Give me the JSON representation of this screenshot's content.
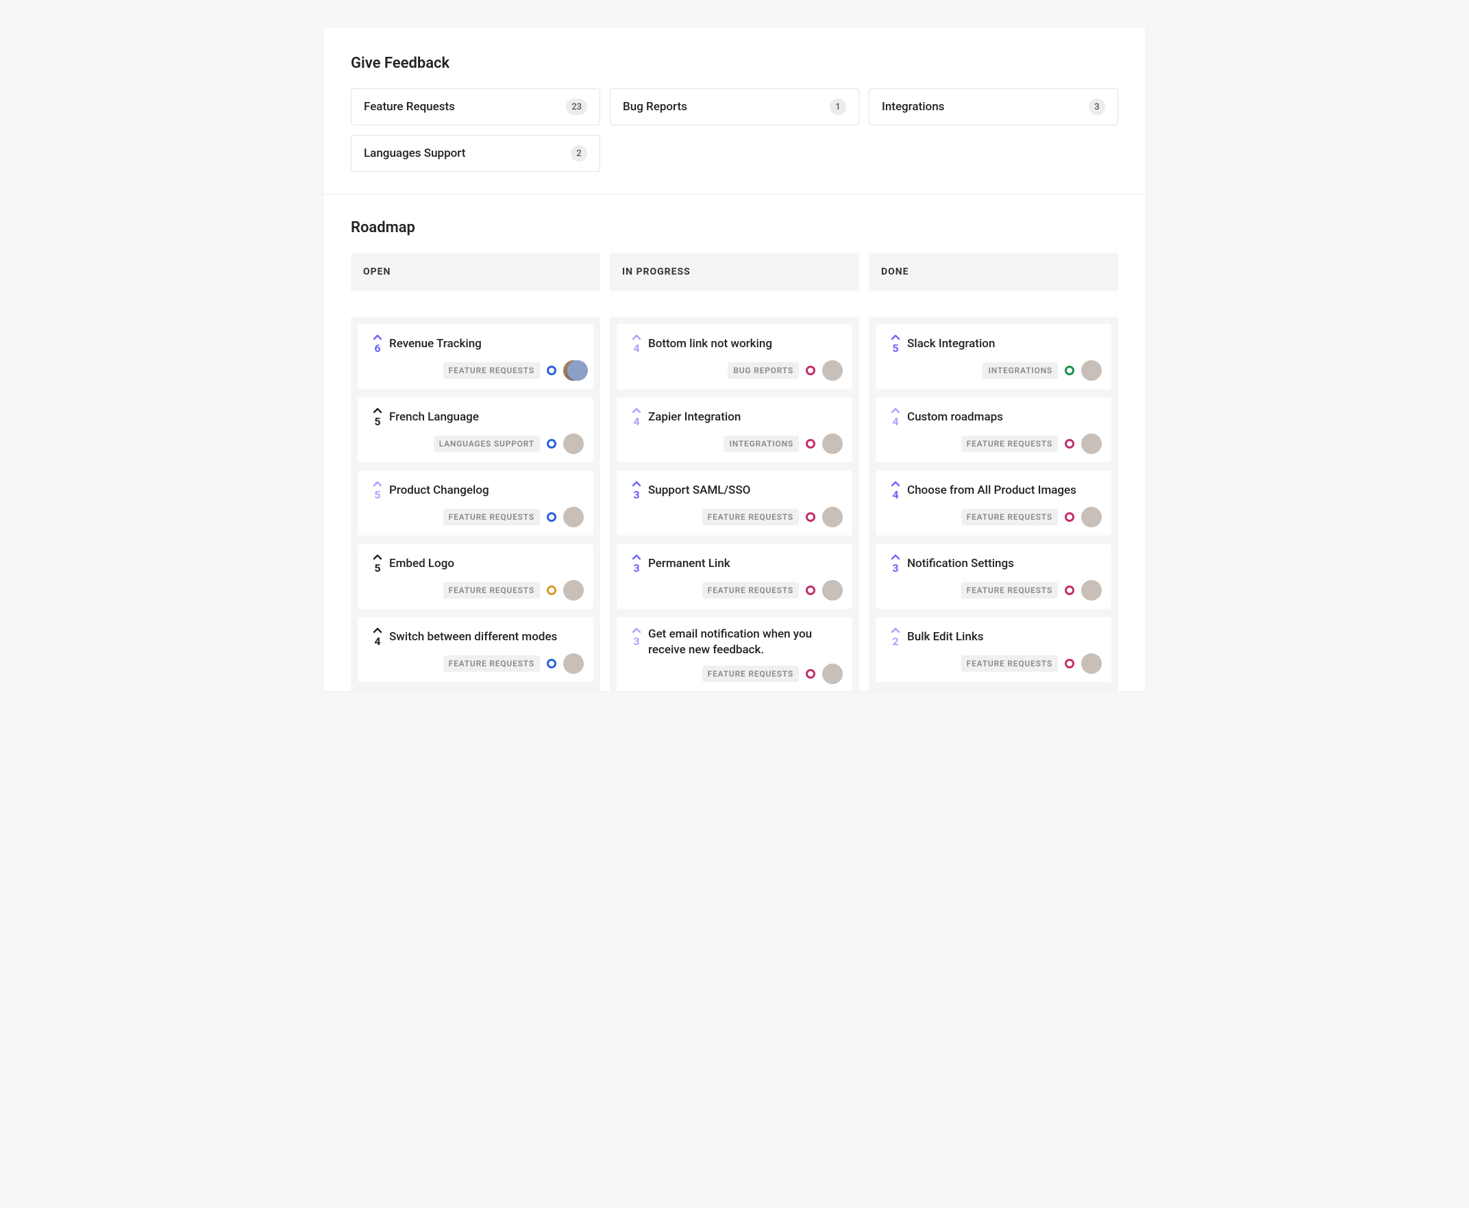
{
  "feedback": {
    "title": "Give Feedback",
    "boards": [
      {
        "label": "Feature Requests",
        "count": "23"
      },
      {
        "label": "Bug Reports",
        "count": "1"
      },
      {
        "label": "Integrations",
        "count": "3"
      },
      {
        "label": "Languages Support",
        "count": "2"
      }
    ]
  },
  "roadmap": {
    "title": "Roadmap",
    "columns": [
      {
        "label": "OPEN",
        "cards": [
          {
            "votes": "6",
            "title": "Revenue Tracking",
            "category": "FEATURE REQUESTS",
            "status_color": "#2962d9",
            "vote_color": "#6b63ff",
            "avatar": "group"
          },
          {
            "votes": "5",
            "title": "French Language",
            "category": "LANGUAGES SUPPORT",
            "status_color": "#2962d9",
            "vote_color": "#222222",
            "avatar": "single"
          },
          {
            "votes": "5",
            "title": "Product Changelog",
            "category": "FEATURE REQUESTS",
            "status_color": "#2962d9",
            "vote_color": "#a9a3ff",
            "avatar": "single"
          },
          {
            "votes": "5",
            "title": "Embed Logo",
            "category": "FEATURE REQUESTS",
            "status_color": "#d99a29",
            "vote_color": "#222222",
            "avatar": "single"
          },
          {
            "votes": "4",
            "title": "Switch between different modes",
            "category": "FEATURE REQUESTS",
            "status_color": "#2962d9",
            "vote_color": "#222222",
            "avatar": "single"
          }
        ]
      },
      {
        "label": "IN PROGRESS",
        "cards": [
          {
            "votes": "4",
            "title": "Bottom link not working",
            "category": "BUG REPORTS",
            "status_color": "#c42d6b",
            "vote_color": "#a9a3ff",
            "avatar": "single"
          },
          {
            "votes": "4",
            "title": "Zapier Integration",
            "category": "INTEGRATIONS",
            "status_color": "#c42d6b",
            "vote_color": "#a9a3ff",
            "avatar": "single"
          },
          {
            "votes": "3",
            "title": "Support SAML/SSO",
            "category": "FEATURE REQUESTS",
            "status_color": "#c42d6b",
            "vote_color": "#6b63ff",
            "avatar": "single"
          },
          {
            "votes": "3",
            "title": "Permanent Link",
            "category": "FEATURE REQUESTS",
            "status_color": "#c42d6b",
            "vote_color": "#6b63ff",
            "avatar": "single"
          },
          {
            "votes": "3",
            "title": "Get email notification when you receive new feedback.",
            "category": "FEATURE REQUESTS",
            "status_color": "#c42d6b",
            "vote_color": "#a9a3ff",
            "avatar": "single"
          }
        ]
      },
      {
        "label": "DONE",
        "cards": [
          {
            "votes": "5",
            "title": "Slack Integration",
            "category": "INTEGRATIONS",
            "status_color": "#1c8f4e",
            "vote_color": "#6b63ff",
            "avatar": "single"
          },
          {
            "votes": "4",
            "title": "Custom roadmaps",
            "category": "FEATURE REQUESTS",
            "status_color": "#c42d6b",
            "vote_color": "#a9a3ff",
            "avatar": "single"
          },
          {
            "votes": "4",
            "title": "Choose from All Product Images",
            "category": "FEATURE REQUESTS",
            "status_color": "#c42d6b",
            "vote_color": "#6b63ff",
            "avatar": "single"
          },
          {
            "votes": "3",
            "title": "Notification Settings",
            "category": "FEATURE REQUESTS",
            "status_color": "#c42d6b",
            "vote_color": "#6b63ff",
            "avatar": "single"
          },
          {
            "votes": "2",
            "title": "Bulk Edit Links",
            "category": "FEATURE REQUESTS",
            "status_color": "#c42d6b",
            "vote_color": "#a9a3ff",
            "avatar": "single"
          }
        ]
      }
    ]
  }
}
